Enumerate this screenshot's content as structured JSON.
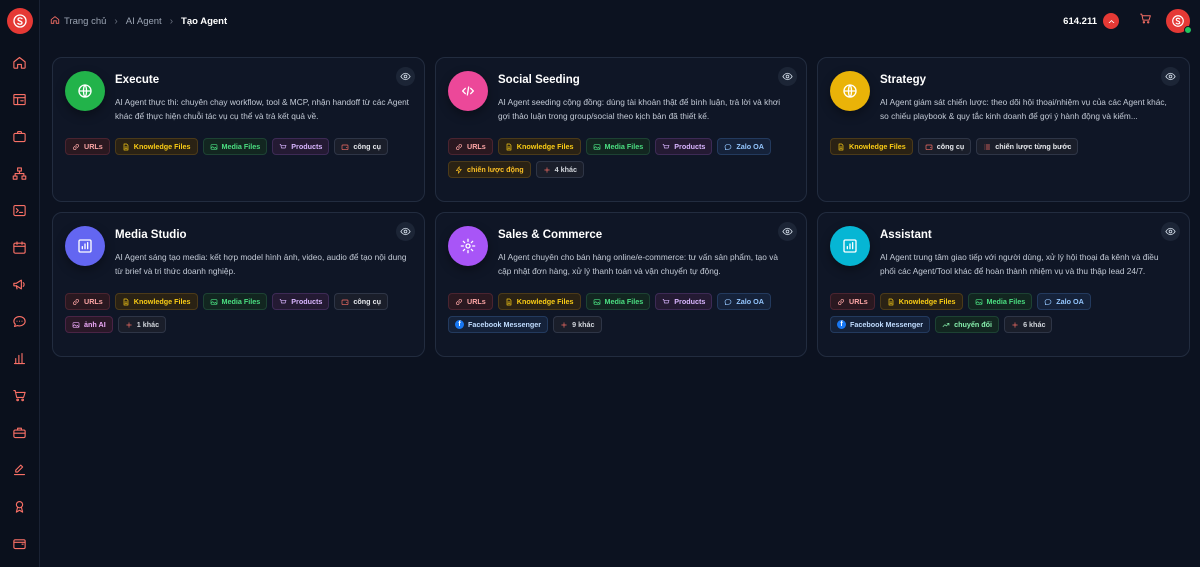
{
  "header": {
    "breadcrumb": [
      "Trang chủ",
      "AI Agent",
      "Tạo Agent"
    ],
    "balance": "614.211"
  },
  "colors": {
    "accent": "#e53935",
    "execute": "#22b34a",
    "social": "#ec4899",
    "strategy": "#eab308",
    "media": "#6366f1",
    "sales": "#a855f7",
    "assistant": "#06b6d4"
  },
  "sidebar": {
    "icons": [
      "home-icon",
      "layout-icon",
      "briefcase-icon",
      "sitemap-icon",
      "terminal-icon",
      "calendar-icon",
      "megaphone-icon",
      "chat-icon",
      "bar-chart-icon",
      "cart-icon",
      "toolbox-icon",
      "edit-icon",
      "award-icon",
      "wallet-icon"
    ]
  },
  "cards": [
    {
      "title": "Execute",
      "desc": "AI Agent thực thi: chuyên chạy workflow, tool & MCP, nhận handoff từ các Agent khác để thực hiện chuỗi tác vụ cụ thể và trả kết quả về.",
      "icon": "globe-icon",
      "tags": [
        "URLs",
        "Knowledge Files",
        "Media Files",
        "Products",
        "công cụ"
      ]
    },
    {
      "title": "Social Seeding",
      "desc": "AI Agent seeding cộng đồng: dùng tài khoản thật để bình luận, trả lời và khơi gợi thảo luận trong group/social theo kịch bản đã thiết kế.",
      "icon": "code-icon",
      "tags": [
        "URLs",
        "Knowledge Files",
        "Media Files",
        "Products",
        "Zalo OA",
        "chiến lược động",
        "4 khác"
      ]
    },
    {
      "title": "Strategy",
      "desc": "AI Agent giám sát chiến lược: theo dõi hội thoại/nhiệm vụ của các Agent khác, so chiếu playbook & quy tắc kinh doanh để gợi ý hành động và kiểm...",
      "icon": "globe-icon",
      "tags": [
        "Knowledge Files",
        "công cụ",
        "chiến lược từng bước"
      ]
    },
    {
      "title": "Media Studio",
      "desc": "AI Agent sáng tạo media: kết hợp model hình ảnh, video, audio để tạo nội dung từ brief và tri thức doanh nghiệp.",
      "icon": "bars-icon",
      "tags": [
        "URLs",
        "Knowledge Files",
        "Media Files",
        "Products",
        "công cụ",
        "ảnh AI",
        "1 khác"
      ]
    },
    {
      "title": "Sales & Commerce",
      "desc": "AI Agent chuyên cho bán hàng online/e-commerce: tư vấn sản phẩm, tạo và cập nhật đơn hàng, xử lý thanh toán và vận chuyển tự động.",
      "icon": "settings-icon",
      "tags": [
        "URLs",
        "Knowledge Files",
        "Media Files",
        "Products",
        "Zalo OA",
        "Facebook Messenger",
        "9 khác"
      ]
    },
    {
      "title": "Assistant",
      "desc": "AI Agent trung tâm giao tiếp với người dùng, xử lý hội thoại đa kênh và điều phối các Agent/Tool khác để hoàn thành nhiệm vụ và thu thập lead 24/7.",
      "icon": "bars-icon",
      "tags": [
        "URLs",
        "Knowledge Files",
        "Media Files",
        "Zalo OA",
        "Facebook Messenger",
        "chuyển đổi",
        "6 khác"
      ]
    }
  ]
}
